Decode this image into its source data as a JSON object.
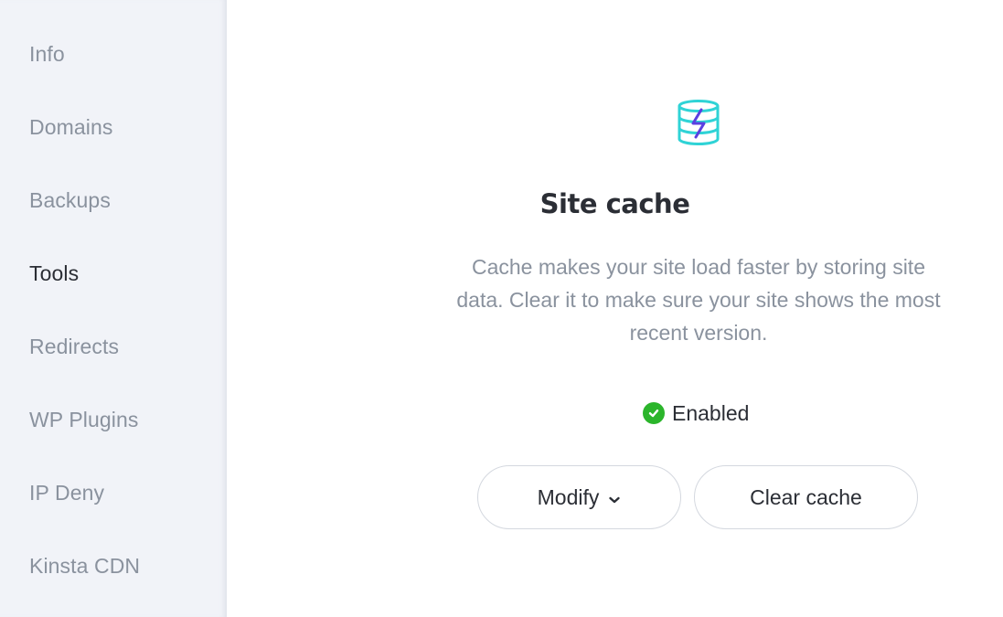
{
  "sidebar": {
    "items": [
      {
        "label": "Info",
        "active": false
      },
      {
        "label": "Domains",
        "active": false
      },
      {
        "label": "Backups",
        "active": false
      },
      {
        "label": "Tools",
        "active": true
      },
      {
        "label": "Redirects",
        "active": false
      },
      {
        "label": "WP Plugins",
        "active": false
      },
      {
        "label": "IP Deny",
        "active": false
      },
      {
        "label": "Kinsta CDN",
        "active": false
      }
    ]
  },
  "main": {
    "icon": "database-lightning-icon",
    "title": "Site cache",
    "description": "Cache makes your site load faster by storing site data. Clear it to make sure your site shows the most recent version.",
    "status": {
      "icon": "check-circle-icon",
      "label": "Enabled",
      "color": "#2bb52b"
    },
    "buttons": {
      "modify_label": "Modify",
      "clear_label": "Clear cache"
    }
  },
  "colors": {
    "icon_teal": "#2fd3d6",
    "icon_purple": "#5b3fe0",
    "text_dark": "#2b2e35",
    "text_muted": "#8a929e",
    "sidebar_bg": "#f1f3f8"
  }
}
